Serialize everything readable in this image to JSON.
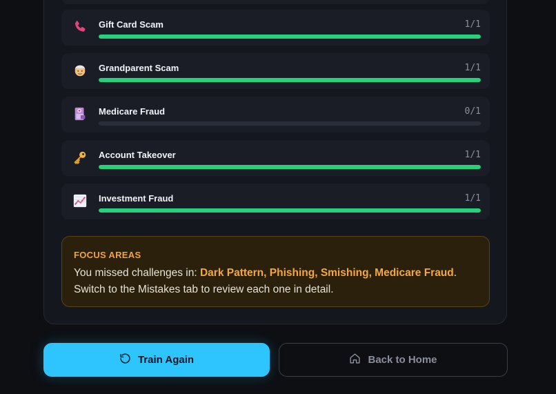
{
  "progress": {
    "items": [
      {
        "label": "Gift Card Scam",
        "count": "1/1",
        "fraction": 1.0,
        "icon": "phone-icon"
      },
      {
        "label": "Grandparent Scam",
        "count": "1/1",
        "fraction": 1.0,
        "icon": "older-person-icon"
      },
      {
        "label": "Medicare Fraud",
        "count": "0/1",
        "fraction": 0.0,
        "icon": "medical-card-icon"
      },
      {
        "label": "Account Takeover",
        "count": "1/1",
        "fraction": 1.0,
        "icon": "key-icon"
      },
      {
        "label": "Investment Fraud",
        "count": "1/1",
        "fraction": 1.0,
        "icon": "chart-up-icon"
      }
    ]
  },
  "focus": {
    "title": "FOCUS AREAS",
    "prefix": "You missed challenges in: ",
    "missed": "Dark Pattern, Phishing, Smishing, Medicare Fraud",
    "suffix": ". Switch to the Mistakes tab to review each one in detail."
  },
  "actions": {
    "train_again": "Train Again",
    "back_home": "Back to Home"
  },
  "colors": {
    "progress_fill": "#27d07a",
    "accent": "#2ec5ff",
    "focus_highlight": "#f6a73b"
  }
}
